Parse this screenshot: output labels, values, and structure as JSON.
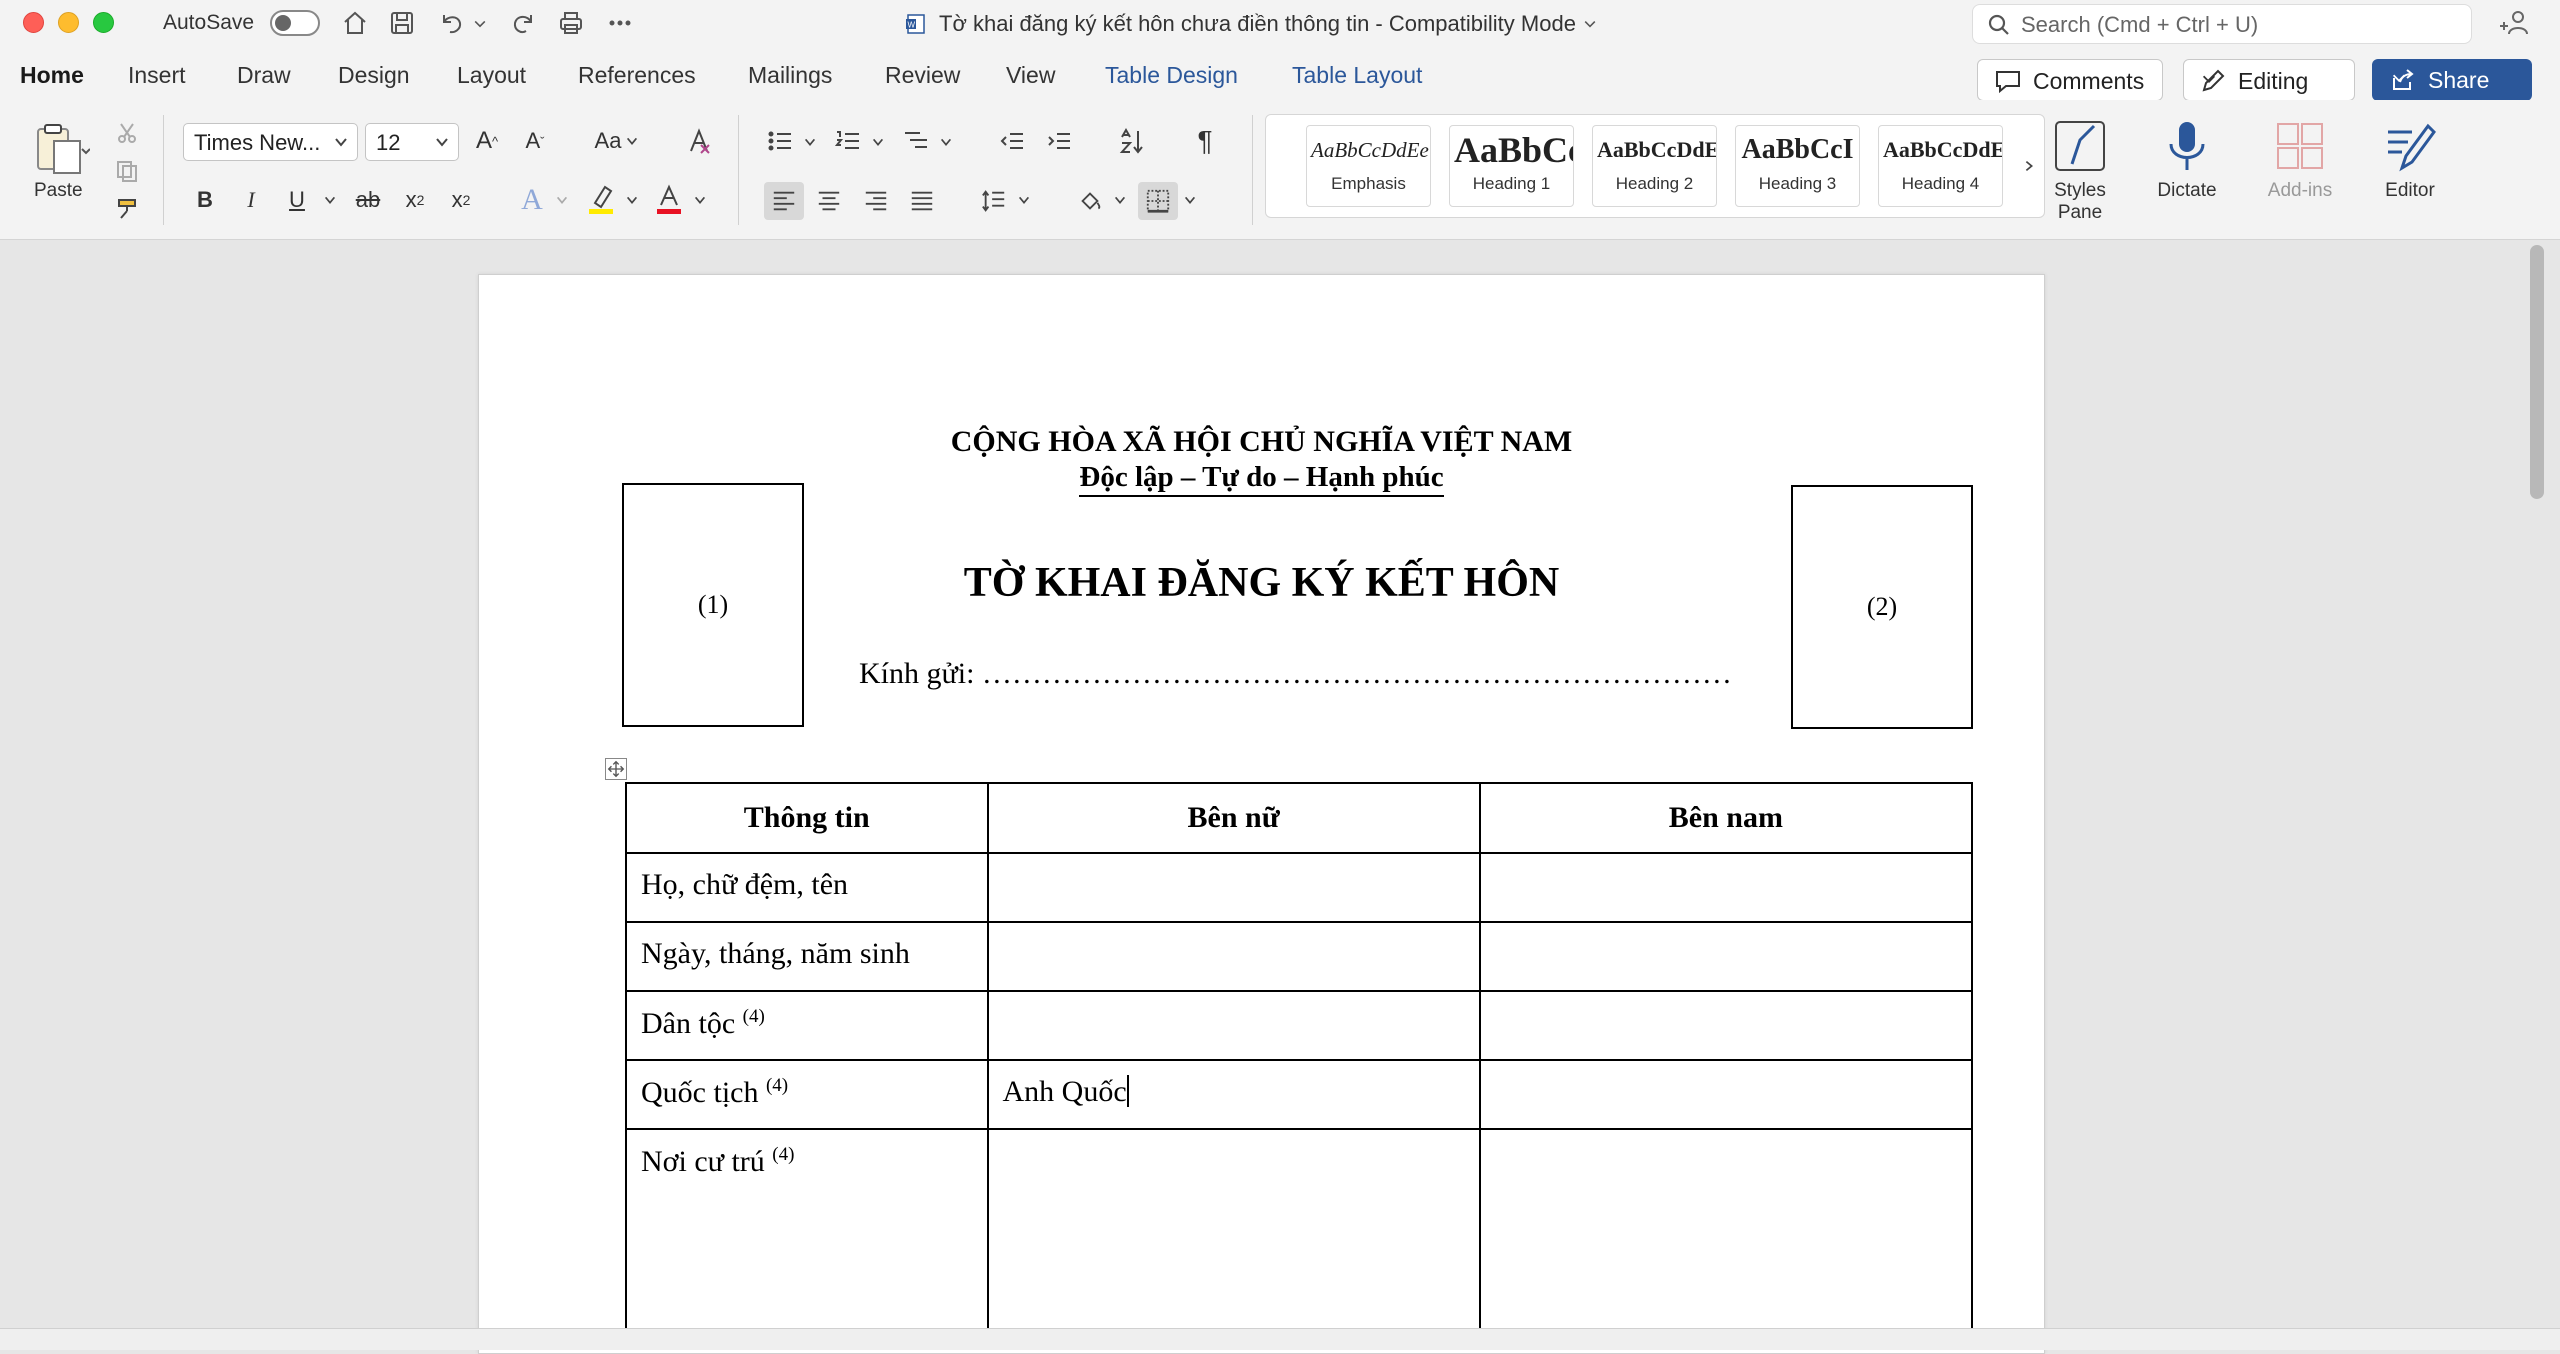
{
  "titlebar": {
    "autosave_label": "AutoSave",
    "document_title": "Tờ khai đăng ký kết hôn chưa điền thông tin  -  Compatibility Mode",
    "search_placeholder": "Search (Cmd + Ctrl + U)"
  },
  "tabs": [
    "Home",
    "Insert",
    "Draw",
    "Design",
    "Layout",
    "References",
    "Mailings",
    "Review",
    "View",
    "Table Design",
    "Table Layout"
  ],
  "active_tab": "Home",
  "actions": {
    "comments": "Comments",
    "editing": "Editing",
    "share": "Share"
  },
  "ribbon": {
    "paste_label": "Paste",
    "font_name": "Times New...",
    "font_size": "12",
    "change_case": "Aa",
    "styles": [
      {
        "preview": "AaBbCcDdEe",
        "name": "Emphasis"
      },
      {
        "preview": "AaBbCc",
        "name": "Heading 1"
      },
      {
        "preview": "AaBbCcDdE",
        "name": "Heading 2"
      },
      {
        "preview": "AaBbCcI",
        "name": "Heading 3"
      },
      {
        "preview": "AaBbCcDdE",
        "name": "Heading 4"
      }
    ],
    "styles_pane": "Styles Pane",
    "dictate": "Dictate",
    "addins": "Add-ins",
    "editor": "Editor"
  },
  "colors": {
    "accent": "#2b579a",
    "highlight": "#ffeb00",
    "font_color": "#e81123"
  },
  "document": {
    "header_line1": "CỘNG HÒA XÃ HỘI CHỦ NGHĨA VIỆT NAM",
    "header_line2": "Độc lập – Tự do – Hạnh phúc",
    "title": "TỜ KHAI ĐĂNG KÝ KẾT HÔN",
    "addressee": "Kính gửi: …………………………………………………………………",
    "photo_left": "(1)",
    "photo_right": "(2)",
    "table": {
      "headers": [
        "Thông tin",
        "Bên nữ",
        "Bên nam"
      ],
      "rows": [
        {
          "label": "Họ, chữ đệm, tên",
          "sup": "",
          "female": "",
          "male": ""
        },
        {
          "label": "Ngày, tháng, năm sinh",
          "sup": "",
          "female": "",
          "male": ""
        },
        {
          "label": "Dân tộc ",
          "sup": "(4)",
          "female": "",
          "male": ""
        },
        {
          "label": "Quốc tịch ",
          "sup": "(4)",
          "female": "Anh Quốc",
          "male": ""
        },
        {
          "label": "Nơi cư trú ",
          "sup": "(4)",
          "female": "",
          "male": ""
        }
      ]
    }
  }
}
